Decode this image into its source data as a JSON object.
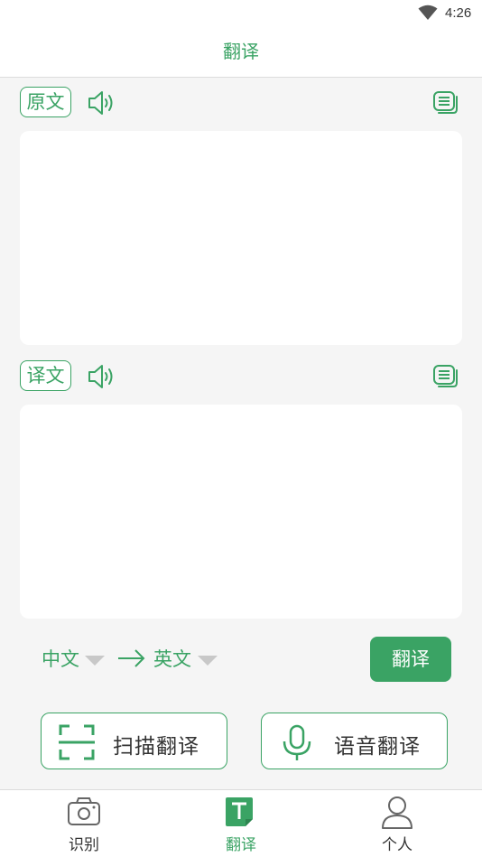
{
  "status_bar": {
    "time": "4:26"
  },
  "header": {
    "title": "翻译"
  },
  "source": {
    "tag": "原文"
  },
  "target": {
    "tag": "译文"
  },
  "languages": {
    "from": "中文",
    "to": "英文"
  },
  "actions": {
    "translate": "翻译",
    "scan": "扫描翻译",
    "voice": "语音翻译"
  },
  "nav": [
    {
      "label": "识别",
      "icon": "camera-icon"
    },
    {
      "label": "翻译",
      "icon": "translate-icon",
      "active": true
    },
    {
      "label": "个人",
      "icon": "person-icon"
    }
  ],
  "colors": {
    "accent": "#3aa364",
    "background": "#f5f5f5"
  }
}
